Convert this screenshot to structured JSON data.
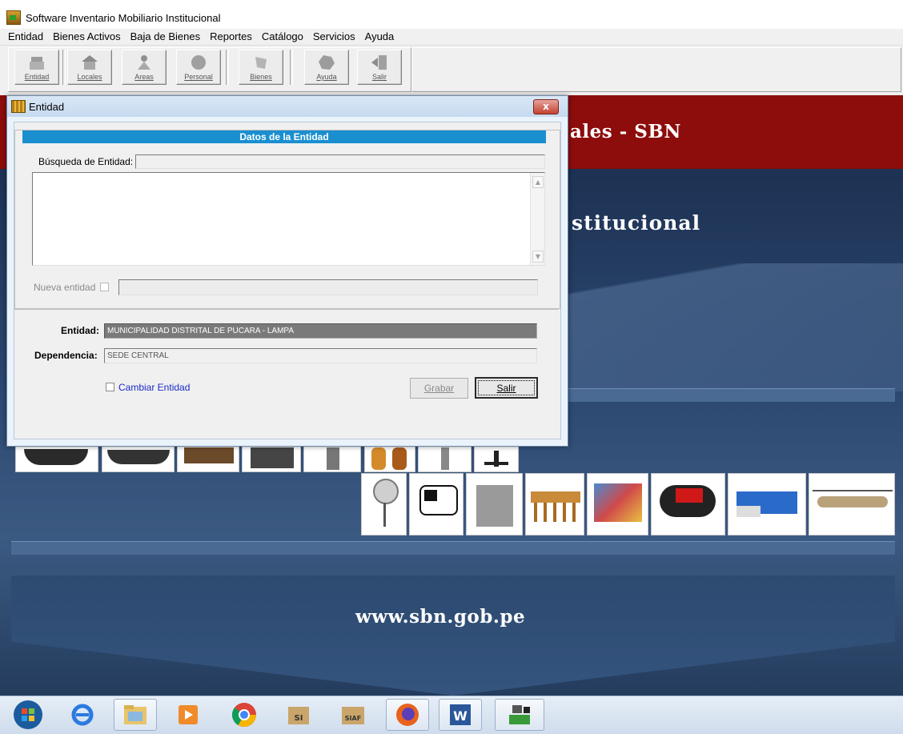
{
  "app": {
    "title": "Software Inventario Mobiliario Institucional"
  },
  "menu": [
    "Entidad",
    "Bienes Activos",
    "Baja de Bienes",
    "Reportes",
    "Catálogo",
    "Servicios",
    "Ayuda"
  ],
  "toolbar": {
    "entidad": "Entidad",
    "locales": "Locales",
    "areas": "Areas",
    "personal": "Personal",
    "bienes": "Bienes",
    "ayuda": "Ayuda",
    "salir": "Salir"
  },
  "background": {
    "banner_text": "ales - SBN",
    "subtitle_text": "stitucional",
    "website": "www.sbn.gob.pe"
  },
  "dialog": {
    "title": "Entidad",
    "close_label": "x",
    "section_title": "Datos de la Entidad",
    "busqueda_label": "Búsqueda de Entidad:",
    "busqueda_value": "",
    "nueva_entidad_label": "Nueva entidad",
    "nueva_entidad_value": "",
    "entidad_label": "Entidad:",
    "entidad_value": "MUNICIPALIDAD DISTRITAL DE PUCARA - LAMPA",
    "dependencia_label": "Dependencia:",
    "dependencia_value": "SEDE CENTRAL",
    "cambiar_entidad_label": "Cambiar Entidad",
    "grabar_label": "Grabar",
    "salir_label": "Salir"
  },
  "colors": {
    "section_header": "#1a8fd0",
    "banner_red": "#8d0c0c",
    "background_blue": "#1f3150",
    "entidad_field": "#7a7a7a"
  },
  "taskbar": [
    "start-orb-icon",
    "internet-explorer-icon",
    "file-explorer-icon",
    "media-player-icon",
    "chrome-icon",
    "sia-icon",
    "siaf-icon",
    "firefox-icon",
    "word-icon",
    "inventory-app-icon"
  ]
}
